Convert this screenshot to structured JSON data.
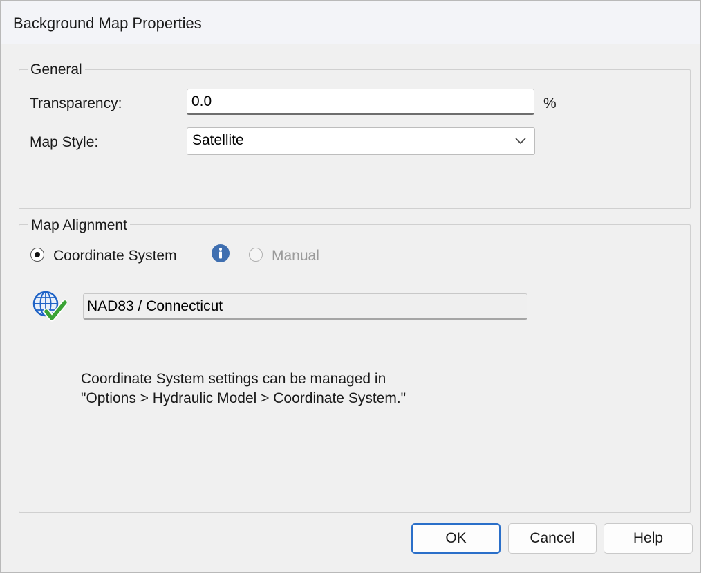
{
  "window": {
    "title": "Background Map Properties"
  },
  "general": {
    "legend": "General",
    "transparency_label": "Transparency:",
    "transparency_value": "0.0",
    "transparency_unit": "%",
    "map_style_label": "Map Style:",
    "map_style_value": "Satellite"
  },
  "alignment": {
    "legend": "Map Alignment",
    "option_coordinate": "Coordinate System",
    "option_manual": "Manual",
    "coordinate_system_value": "NAD83 / Connecticut",
    "note_line1": "Coordinate System settings can be managed in",
    "note_line2": "\"Options > Hydraulic Model > Coordinate System.\""
  },
  "buttons": {
    "ok": "OK",
    "cancel": "Cancel",
    "help": "Help"
  },
  "colors": {
    "accent": "#2a6fc9",
    "info": "#3f6fb0",
    "check": "#3aa335",
    "globe": "#1f63c6"
  },
  "icons": {
    "info": "info-icon",
    "globe": "globe-check-icon",
    "dropdown": "chevron-down-icon"
  }
}
